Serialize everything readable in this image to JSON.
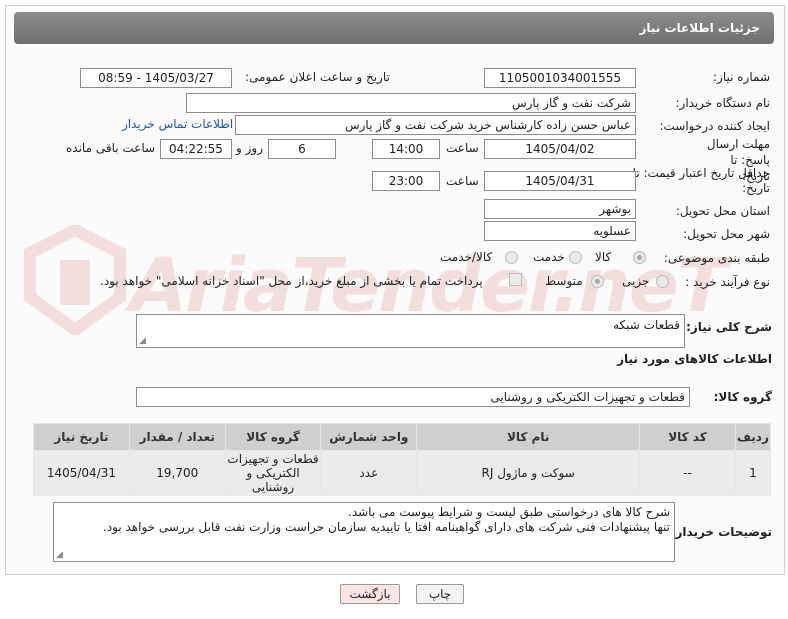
{
  "header": {
    "title": "جزئیات اطلاعات نیاز"
  },
  "fields": {
    "need_number_label": "شماره نیاز:",
    "need_number": "1105001034001555",
    "announce_label": "تاریخ و ساعت اعلان عمومی:",
    "announce_value": "1405/03/27 - 08:59",
    "buyer_org_label": "نام دستگاه خریدار:",
    "buyer_org": "شرکت نفت و گاز پارس",
    "creator_label": "ایجاد کننده درخواست:",
    "creator": "عباس حسن زاده کارشناس خرید شرکت نفت و گاز پارس",
    "contact_link": "اطلاعات تماس خریدار",
    "deadline_label": "مهلت ارسال پاسخ: تا تاریخ:",
    "deadline_date": "1405/04/02",
    "time_label": "ساعت",
    "deadline_time": "14:00",
    "days_value": "6",
    "days_label": "روز و",
    "remaining_time": "04:22:55",
    "remaining_label": "ساعت باقی مانده",
    "validity_label": "حداقل تاریخ اعتبار قیمت: تا تاریخ:",
    "validity_date": "1405/04/31",
    "validity_time": "23:00",
    "province_label": "استان محل تحویل:",
    "province": "بوشهر",
    "city_label": "شهر محل تحویل:",
    "city": "عسلویه",
    "category_label": "طبقه بندی موضوعی:",
    "category_options": [
      "کالا",
      "خدمت",
      "کالا/خدمت"
    ],
    "process_label": "نوع فرآیند خرید :",
    "process_options": [
      "جزیی",
      "متوسط"
    ],
    "payment_note": "پرداخت تمام یا بخشی از مبلغ خرید،از محل \"اسناد خزانه اسلامی\" خواهد بود."
  },
  "description": {
    "label": "شرح کلی نیاز:",
    "value": "قطعات شبکه"
  },
  "goods": {
    "section_title": "اطلاعات کالاهای مورد نیاز",
    "group_label": "گروه کالا:",
    "group_value": "قطعات و تجهیزات الکتریکی و روشنایی",
    "columns": [
      "ردیف",
      "کد کالا",
      "نام کالا",
      "واحد شمارش",
      "گروه کالا",
      "تعداد / مقدار",
      "تاریخ نیاز"
    ],
    "rows": [
      {
        "row": "1",
        "code": "--",
        "name": "سوکت و ماژول RJ",
        "unit": "عدد",
        "group": "قطعات و تجهیزات الکتریکی و روشنایی",
        "qty": "19,700",
        "date": "1405/04/31"
      }
    ]
  },
  "buyer_notes": {
    "label": "توضیحات خریدار:",
    "line1": "شرح کالا های درخواستی طبق لیست و شرایط پیوست می باشد.",
    "line2": "تنها پیشنهادات فنی شرکت های دارای گواهینامه افتا یا تاییدیه سازمان حراست وزارت نفت قابل بررسی خواهد بود."
  },
  "buttons": {
    "print": "چاپ",
    "back": "بازگشت"
  },
  "colors": {
    "header_bg": "#7a7a7a",
    "link": "#1a56b8",
    "back_btn_bg": "#fde3e3",
    "print_btn_bg": "#f3f3f3"
  }
}
